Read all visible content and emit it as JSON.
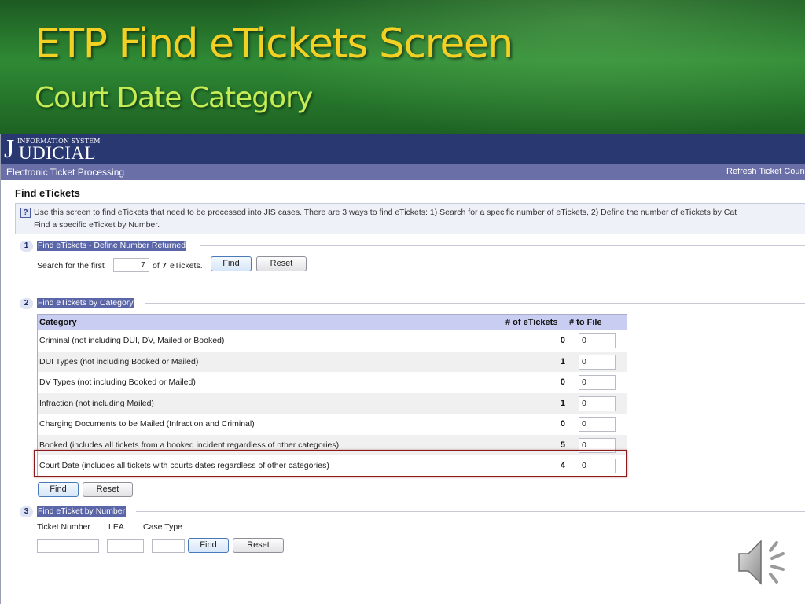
{
  "slide": {
    "title": "ETP Find eTickets Screen",
    "subtitle": "Court Date Category"
  },
  "app": {
    "logo_small": "INFORMATION SYSTEM",
    "logo_j": "J",
    "logo_main": "UDICIAL",
    "module_title": "Electronic Ticket Processing",
    "refresh_link": "Refresh Ticket Coun"
  },
  "page": {
    "title": "Find eTickets",
    "help_line1": "Use this screen to find eTickets that need to be processed into JIS cases. There are 3 ways to find eTickets: 1) Search for a specific number of eTickets, 2) Define the number of eTickets by Cat",
    "help_line2": "Find a specific eTicket by Number."
  },
  "section1": {
    "number": "1",
    "label": "Find eTickets - Define Number Returned",
    "search_prefix": "Search for the first",
    "search_value": "7",
    "of_label": "of",
    "total": "7",
    "suffix": "eTickets.",
    "find_label": "Find",
    "reset_label": "Reset"
  },
  "section2": {
    "number": "2",
    "label": "Find eTickets by Category",
    "columns": [
      "Category",
      "# of eTickets",
      "# to File"
    ],
    "rows": [
      {
        "category": "Criminal (not including DUI, DV, Mailed or Booked)",
        "count": "0",
        "to_file": "0"
      },
      {
        "category": "DUI Types (not including Booked or Mailed)",
        "count": "1",
        "to_file": "0"
      },
      {
        "category": "DV Types (not including Booked or Mailed)",
        "count": "0",
        "to_file": "0"
      },
      {
        "category": "Infraction (not including Mailed)",
        "count": "1",
        "to_file": "0"
      },
      {
        "category": "Charging Documents to be Mailed (Infraction and Criminal)",
        "count": "0",
        "to_file": "0"
      },
      {
        "category": "Booked (includes all tickets from a booked incident regardless of other categories)",
        "count": "5",
        "to_file": "0"
      },
      {
        "category": "Court Date (includes all tickets with courts dates regardless of other categories)",
        "count": "4",
        "to_file": "0"
      }
    ],
    "find_label": "Find",
    "reset_label": "Reset"
  },
  "section3": {
    "number": "3",
    "label": "Find eTicket by Number",
    "ticket_label": "Ticket Number",
    "lea_label": "LEA",
    "case_type_label": "Case Type",
    "find_label": "Find",
    "reset_label": "Reset"
  },
  "icons": {
    "help": "question-icon",
    "speaker": "speaker-icon"
  },
  "colors": {
    "brand_bar": "#2a3872",
    "sub_bar": "#6a6fa8",
    "section_label": "#5b66a8",
    "table_header": "#c9cdf2",
    "highlight": "#8b1a1a",
    "slide_title": "#f2d024",
    "slide_subtitle": "#c6ec55"
  }
}
